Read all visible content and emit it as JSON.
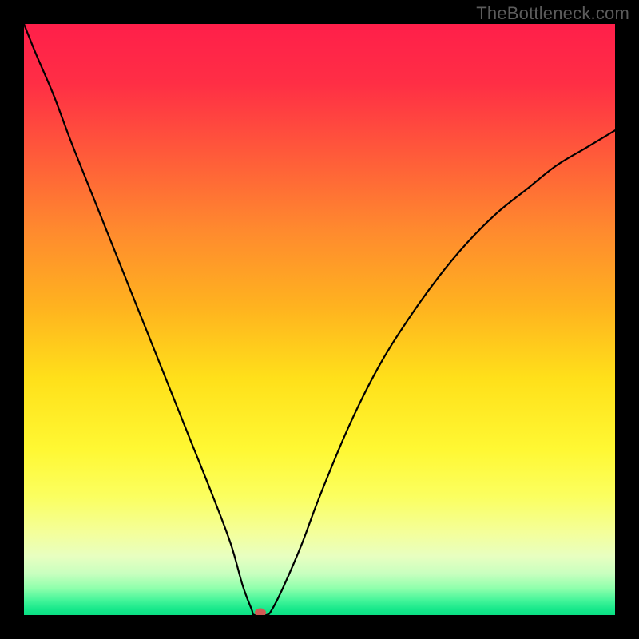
{
  "watermark": "TheBottleneck.com",
  "chart_data": {
    "type": "line",
    "title": "",
    "xlabel": "",
    "ylabel": "",
    "xlim": [
      0,
      100
    ],
    "ylim": [
      0,
      100
    ],
    "grid": false,
    "legend": false,
    "marker": {
      "x": 40,
      "y": 0,
      "color": "#d05a54"
    },
    "curve_percent": [
      {
        "x": 0,
        "y": 100
      },
      {
        "x": 2,
        "y": 95
      },
      {
        "x": 5,
        "y": 88
      },
      {
        "x": 8,
        "y": 80
      },
      {
        "x": 12,
        "y": 70
      },
      {
        "x": 16,
        "y": 60
      },
      {
        "x": 20,
        "y": 50
      },
      {
        "x": 24,
        "y": 40
      },
      {
        "x": 28,
        "y": 30
      },
      {
        "x": 32,
        "y": 20
      },
      {
        "x": 35,
        "y": 12
      },
      {
        "x": 37,
        "y": 5
      },
      {
        "x": 38.5,
        "y": 1
      },
      {
        "x": 39,
        "y": 0
      },
      {
        "x": 41,
        "y": 0
      },
      {
        "x": 42,
        "y": 1
      },
      {
        "x": 44,
        "y": 5
      },
      {
        "x": 47,
        "y": 12
      },
      {
        "x": 50,
        "y": 20
      },
      {
        "x": 55,
        "y": 32
      },
      {
        "x": 60,
        "y": 42
      },
      {
        "x": 65,
        "y": 50
      },
      {
        "x": 70,
        "y": 57
      },
      {
        "x": 75,
        "y": 63
      },
      {
        "x": 80,
        "y": 68
      },
      {
        "x": 85,
        "y": 72
      },
      {
        "x": 90,
        "y": 76
      },
      {
        "x": 95,
        "y": 79
      },
      {
        "x": 100,
        "y": 82
      }
    ],
    "gradient_stops": [
      {
        "offset": 0.0,
        "color": "#ff1f4a"
      },
      {
        "offset": 0.1,
        "color": "#ff2e45"
      },
      {
        "offset": 0.22,
        "color": "#ff5a3a"
      },
      {
        "offset": 0.35,
        "color": "#ff8a2e"
      },
      {
        "offset": 0.48,
        "color": "#ffb31f"
      },
      {
        "offset": 0.6,
        "color": "#ffe01a"
      },
      {
        "offset": 0.72,
        "color": "#fff833"
      },
      {
        "offset": 0.8,
        "color": "#fbff60"
      },
      {
        "offset": 0.86,
        "color": "#f4ff9a"
      },
      {
        "offset": 0.9,
        "color": "#e8ffc0"
      },
      {
        "offset": 0.93,
        "color": "#c8ffbf"
      },
      {
        "offset": 0.955,
        "color": "#8effac"
      },
      {
        "offset": 0.975,
        "color": "#45f59a"
      },
      {
        "offset": 0.99,
        "color": "#17e88b"
      },
      {
        "offset": 1.0,
        "color": "#0be084"
      }
    ]
  }
}
